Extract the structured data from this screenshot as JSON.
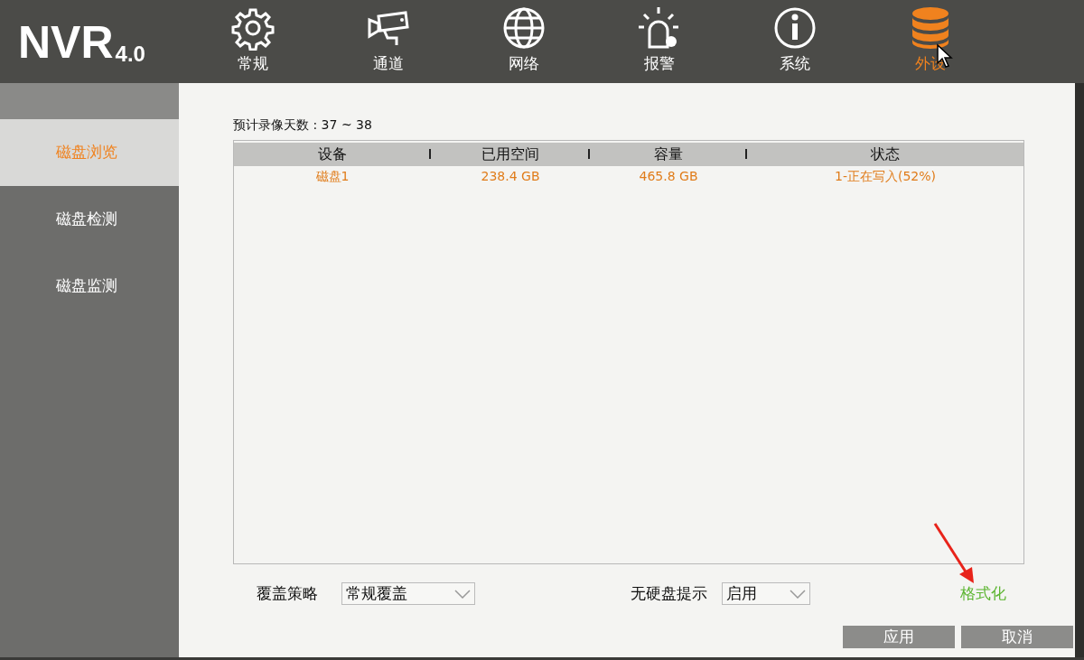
{
  "logo": {
    "text": "NVR",
    "version": "4.0"
  },
  "nav": [
    {
      "label": "常规",
      "kind": "gear",
      "selected": false
    },
    {
      "label": "通道",
      "kind": "camera",
      "selected": false
    },
    {
      "label": "网络",
      "kind": "globe",
      "selected": false
    },
    {
      "label": "报警",
      "kind": "alarm",
      "selected": false
    },
    {
      "label": "系统",
      "kind": "info",
      "selected": false
    },
    {
      "label": "外设",
      "kind": "disk",
      "selected": true
    }
  ],
  "sidebar": {
    "items": [
      {
        "label": "磁盘浏览",
        "selected": true
      },
      {
        "label": "磁盘检测",
        "selected": false
      },
      {
        "label": "磁盘监测",
        "selected": false
      }
    ]
  },
  "estimate": "预计录像天数 : 37 ~ 38",
  "table": {
    "columns": [
      "设备",
      "已用空间",
      "容量",
      "状态"
    ],
    "rows": [
      [
        "磁盘1",
        "238.4 GB",
        "465.8 GB",
        "1-正在写入(52%)"
      ]
    ]
  },
  "overwrite": {
    "label": "覆盖策略",
    "value": "常规覆盖"
  },
  "no_disk_alert": {
    "label": "无硬盘提示",
    "value": "启用"
  },
  "format_link": "格式化",
  "buttons": [
    "应用",
    "取消"
  ]
}
